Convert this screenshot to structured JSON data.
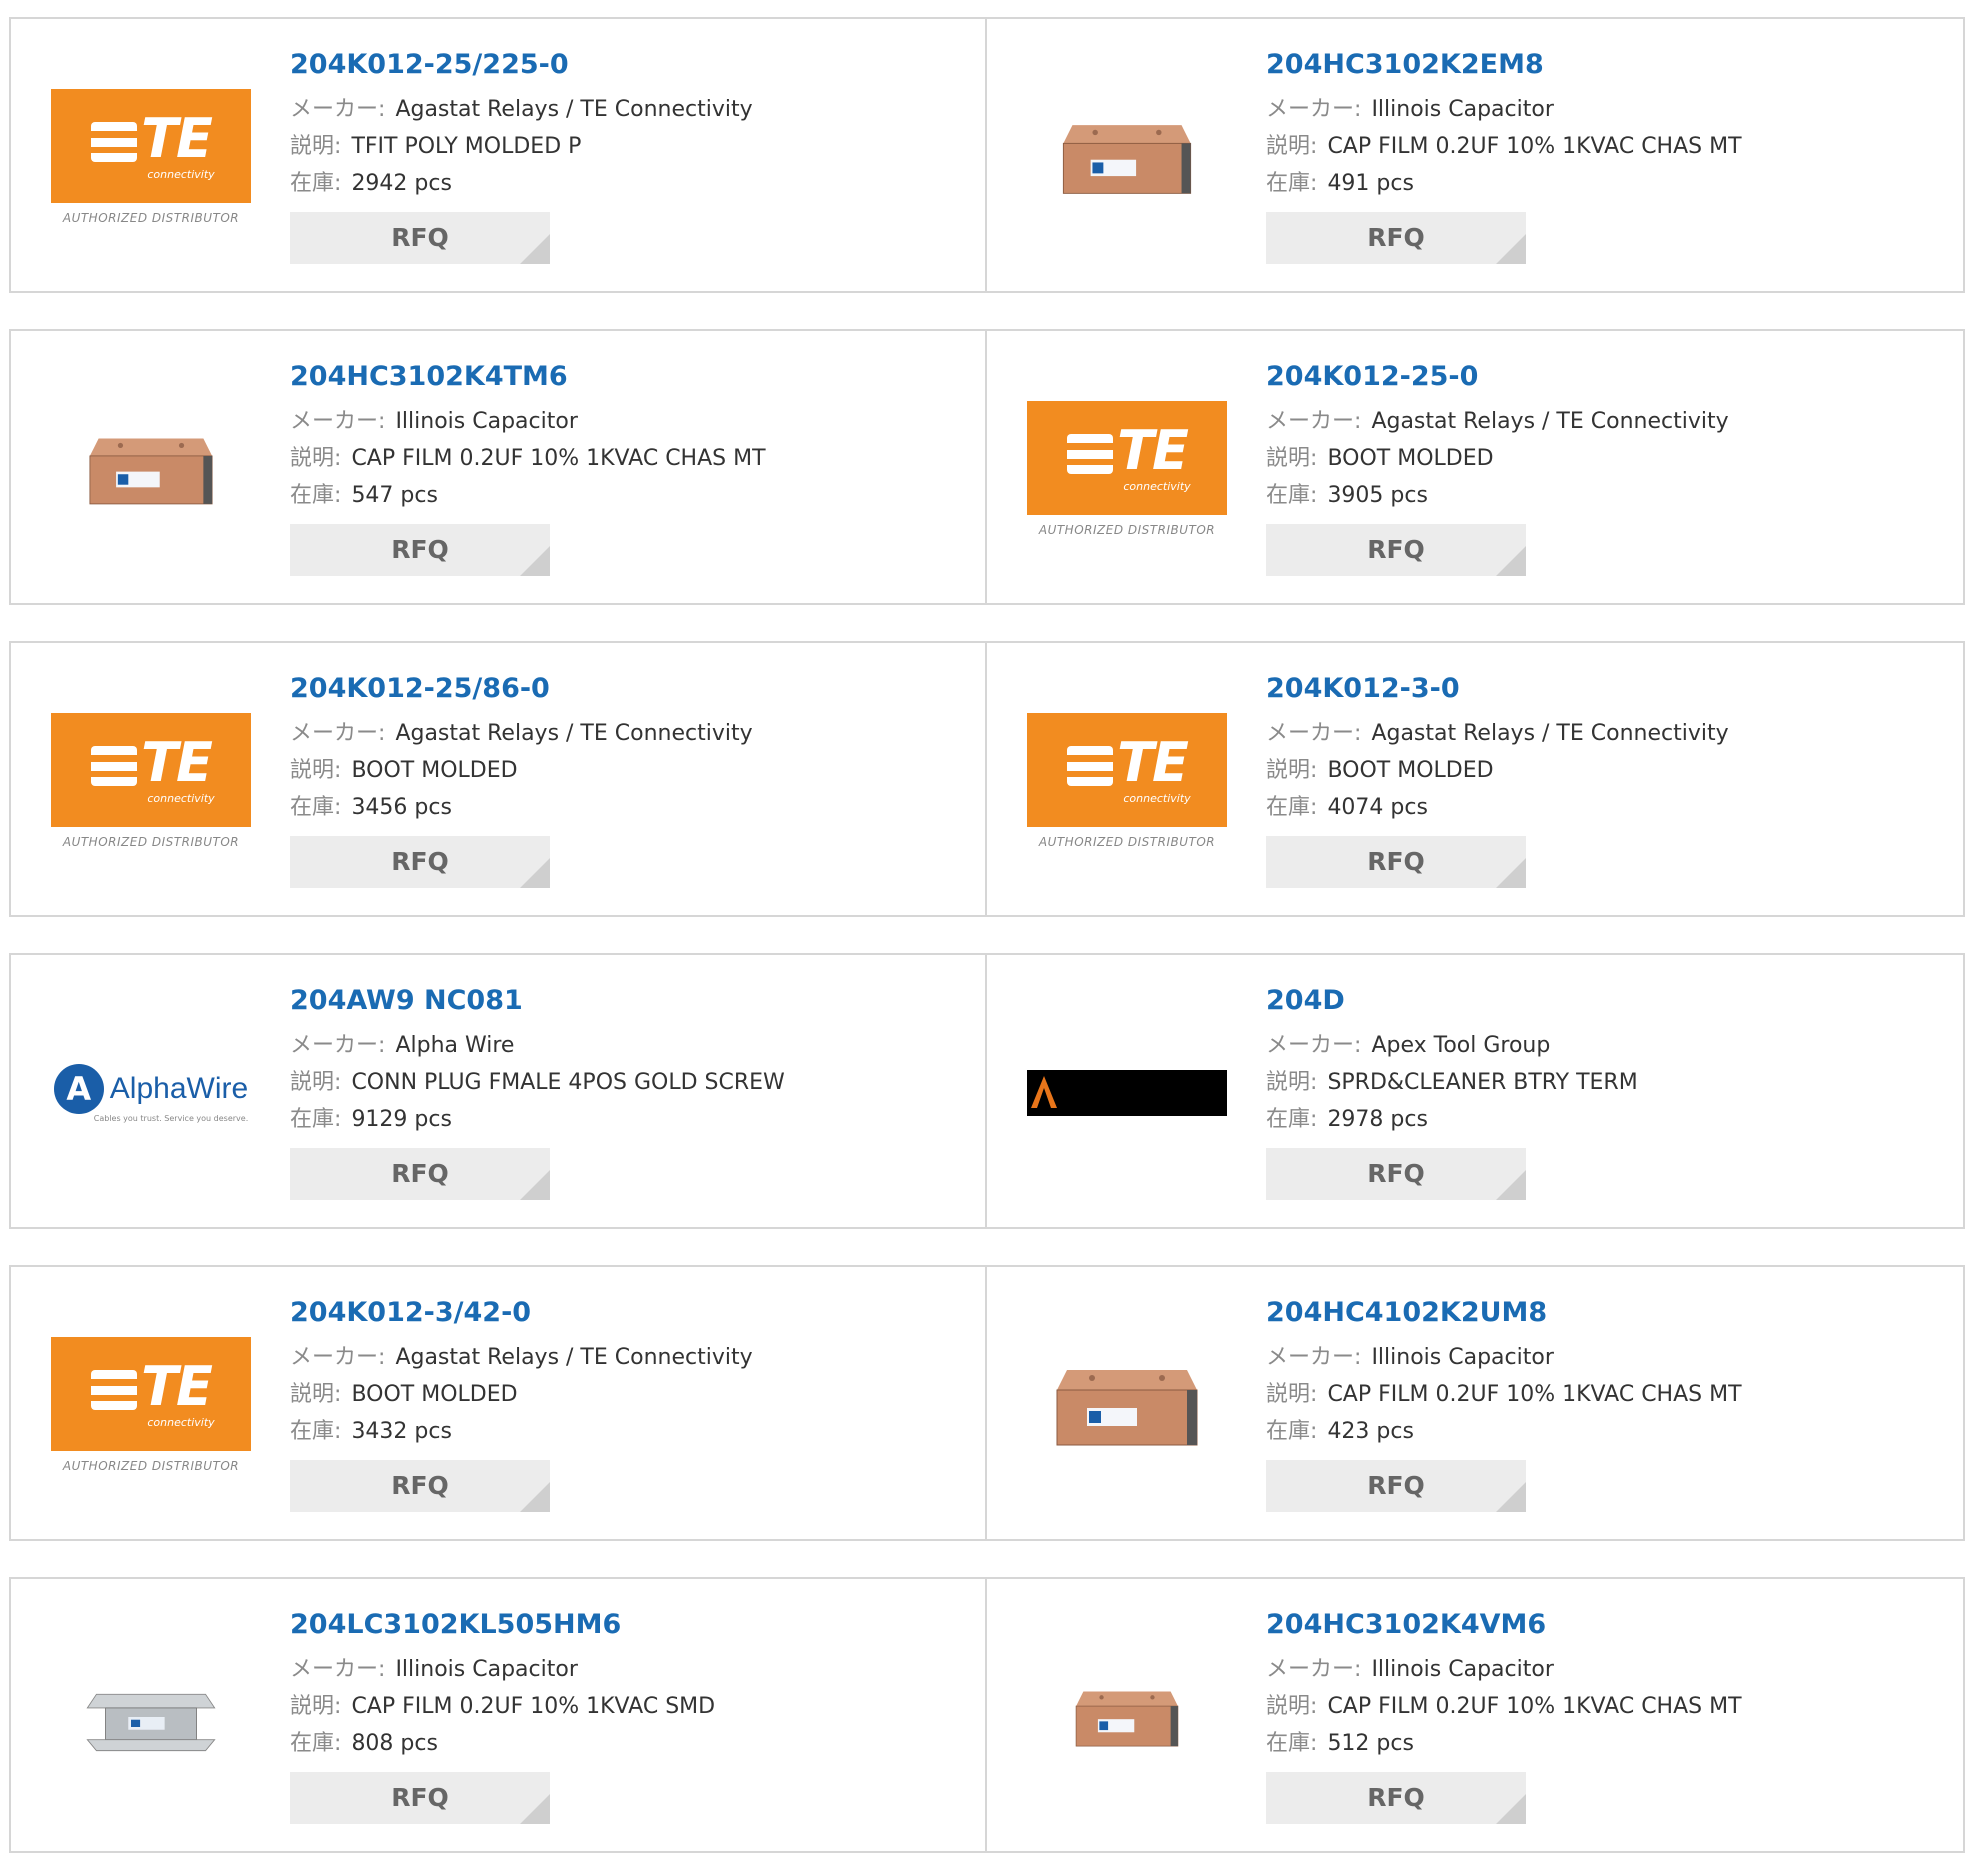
{
  "labels": {
    "maker": "メーカー",
    "desc": "説明",
    "stock": "在庫",
    "colon": ":"
  },
  "colors": {
    "link": "#1a6bb3",
    "te_orange": "#f28c20",
    "alpha_blue": "#1a5ea8"
  },
  "products": [
    {
      "part": "204K012-25/225-0",
      "maker": "Agastat Relays / TE Connectivity",
      "desc": "TFIT POLY MOLDED P",
      "stock": "2942 pcs",
      "rfq": "RFQ",
      "image": "te-logo",
      "logo": {
        "brand": "TE",
        "sub": "connectivity",
        "auth": "AUTHORIZED DISTRIBUTOR"
      }
    },
    {
      "part": "204HC3102K2EM8",
      "maker": "Illinois Capacitor",
      "desc": "CAP FILM 0.2UF 10% 1KVAC CHAS MT",
      "stock": "491 pcs",
      "rfq": "RFQ",
      "image": "capacitor-box"
    },
    {
      "part": "204HC3102K4TM6",
      "maker": "Illinois Capacitor",
      "desc": "CAP FILM 0.2UF 10% 1KVAC CHAS MT",
      "stock": "547 pcs",
      "rfq": "RFQ",
      "image": "capacitor-box"
    },
    {
      "part": "204K012-25-0",
      "maker": "Agastat Relays / TE Connectivity",
      "desc": "BOOT MOLDED",
      "stock": "3905 pcs",
      "rfq": "RFQ",
      "image": "te-logo",
      "logo": {
        "brand": "TE",
        "sub": "connectivity",
        "auth": "AUTHORIZED DISTRIBUTOR"
      }
    },
    {
      "part": "204K012-25/86-0",
      "maker": "Agastat Relays / TE Connectivity",
      "desc": "BOOT MOLDED",
      "stock": "3456 pcs",
      "rfq": "RFQ",
      "image": "te-logo",
      "logo": {
        "brand": "TE",
        "sub": "connectivity",
        "auth": "AUTHORIZED DISTRIBUTOR"
      }
    },
    {
      "part": "204K012-3-0",
      "maker": "Agastat Relays / TE Connectivity",
      "desc": "BOOT MOLDED",
      "stock": "4074 pcs",
      "rfq": "RFQ",
      "image": "te-logo",
      "logo": {
        "brand": "TE",
        "sub": "connectivity",
        "auth": "AUTHORIZED DISTRIBUTOR"
      }
    },
    {
      "part": "204AW9 NC081",
      "maker": "Alpha Wire",
      "desc": "CONN PLUG FMALE 4POS GOLD SCREW",
      "stock": "9129 pcs",
      "rfq": "RFQ",
      "image": "alphawire-logo",
      "logo": {
        "brand": "AlphaWire",
        "sub": "Cables you trust. Service you deserve."
      }
    },
    {
      "part": "204D",
      "maker": "Apex Tool Group",
      "desc": "SPRD&CLEANER BTRY TERM",
      "stock": "2978 pcs",
      "rfq": "RFQ",
      "image": "apex-logo"
    },
    {
      "part": "204K012-3/42-0",
      "maker": "Agastat Relays / TE Connectivity",
      "desc": "BOOT MOLDED",
      "stock": "3432 pcs",
      "rfq": "RFQ",
      "image": "te-logo",
      "logo": {
        "brand": "TE",
        "sub": "connectivity",
        "auth": "AUTHORIZED DISTRIBUTOR"
      }
    },
    {
      "part": "204HC4102K2UM8",
      "maker": "Illinois Capacitor",
      "desc": "CAP FILM 0.2UF 10% 1KVAC CHAS MT",
      "stock": "423 pcs",
      "rfq": "RFQ",
      "image": "capacitor-box"
    },
    {
      "part": "204LC3102KL505HM6",
      "maker": "Illinois Capacitor",
      "desc": "CAP FILM 0.2UF 10% 1KVAC SMD",
      "stock": "808 pcs",
      "rfq": "RFQ",
      "image": "capacitor-smd"
    },
    {
      "part": "204HC3102K4VM6",
      "maker": "Illinois Capacitor",
      "desc": "CAP FILM 0.2UF 10% 1KVAC CHAS MT",
      "stock": "512 pcs",
      "rfq": "RFQ",
      "image": "capacitor-box"
    }
  ]
}
